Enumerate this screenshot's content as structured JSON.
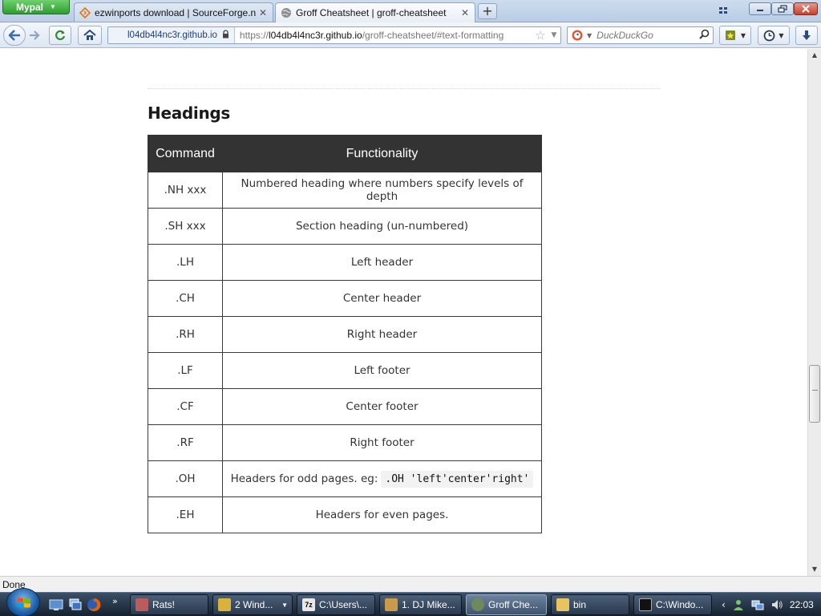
{
  "browser": {
    "app_button": "Mypal",
    "tabs": [
      {
        "label": "ezwinports download | SourceForge.n...",
        "active": false,
        "icon": "sourceforge-icon"
      },
      {
        "label": "Groff Cheatsheet | groff-cheatsheet",
        "active": true,
        "icon": "globe-icon"
      }
    ],
    "identity": "l04db4l4nc3r.github.io",
    "url_prefix": "https://",
    "url_host": "l04db4l4nc3r.github.io",
    "url_path": "/groff-cheatsheet/#text-formatting",
    "search_placeholder": "DuckDuckGo"
  },
  "page": {
    "heading": "Headings",
    "table": {
      "headers": [
        "Command",
        "Functionality"
      ],
      "rows": [
        {
          "cmd": ".NH xxx",
          "desc": "Numbered heading where numbers specify levels of depth"
        },
        {
          "cmd": ".SH xxx",
          "desc": "Section heading (un-numbered)"
        },
        {
          "cmd": ".LH",
          "desc": "Left header"
        },
        {
          "cmd": ".CH",
          "desc": "Center header"
        },
        {
          "cmd": ".RH",
          "desc": "Right header"
        },
        {
          "cmd": ".LF",
          "desc": "Left footer"
        },
        {
          "cmd": ".CF",
          "desc": "Center footer"
        },
        {
          "cmd": ".RF",
          "desc": "Right footer"
        },
        {
          "cmd": ".OH",
          "desc": "Headers for odd pages. eg:",
          "code": ".OH 'left'center'right'"
        },
        {
          "cmd": ".EH",
          "desc": "Headers for even pages."
        }
      ]
    }
  },
  "status": "Done",
  "taskbar": {
    "tasks": [
      {
        "label": "Rats!"
      },
      {
        "label": "2 Wind..."
      },
      {
        "label": "C:\\Users\\..."
      },
      {
        "label": "1. DJ Mike..."
      },
      {
        "label": "Groff Che..."
      },
      {
        "label": "bin"
      },
      {
        "label": "C:\\Windo..."
      }
    ],
    "clock": "22:03"
  },
  "colors": {
    "table_header_bg": "#333333",
    "app_button": "#2e9d2e",
    "close_button": "#c7402b"
  }
}
